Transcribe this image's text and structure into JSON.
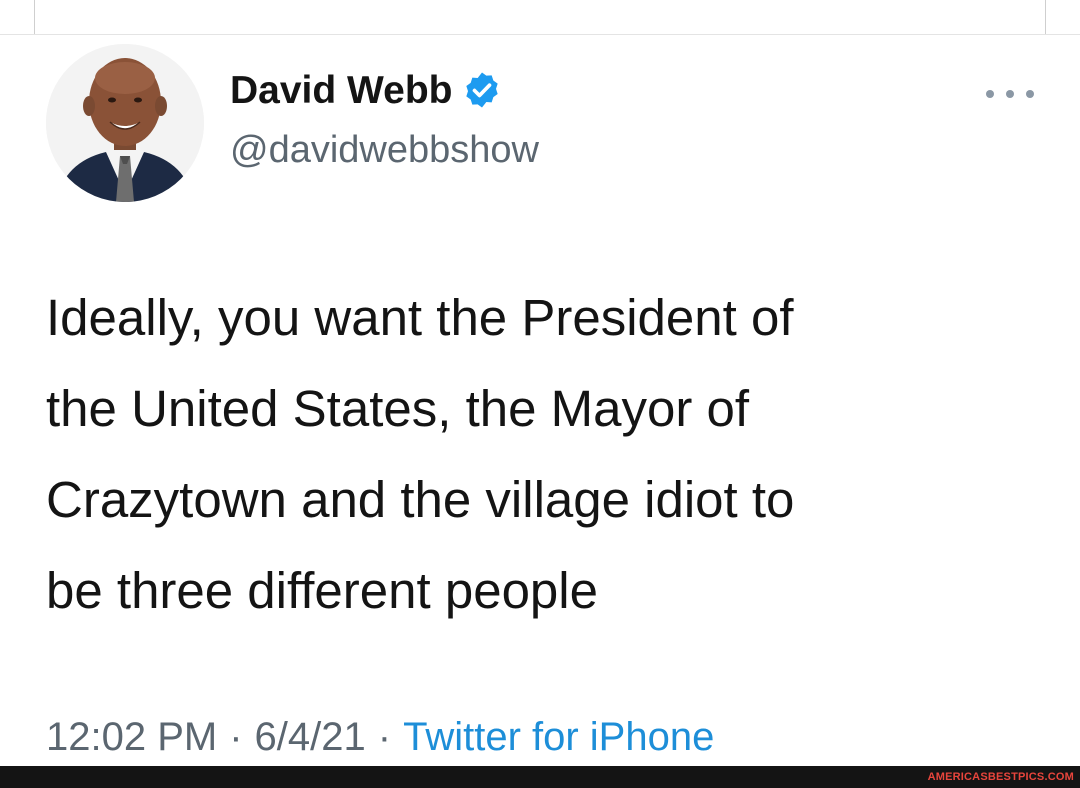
{
  "tweet": {
    "author": {
      "display_name": "David Webb",
      "handle": "@davidwebbshow",
      "verified": true,
      "avatar_icon": "profile-photo"
    },
    "text_lines": [
      "Ideally, you want the President of",
      "the United States, the Mayor of",
      "Crazytown and the village idiot to",
      "be three different people"
    ],
    "time": "12:02 PM",
    "date": "6/4/21",
    "separator": "·",
    "source": "Twitter for iPhone",
    "more_icon": "more-dots-icon"
  },
  "colors": {
    "text": "#141414",
    "muted": "#5b6670",
    "link": "#1d8ed8",
    "verified": "#1d9bf0",
    "watermark": "#e8453c"
  },
  "watermark": {
    "text": "AMERICASBESTPICS.COM"
  }
}
